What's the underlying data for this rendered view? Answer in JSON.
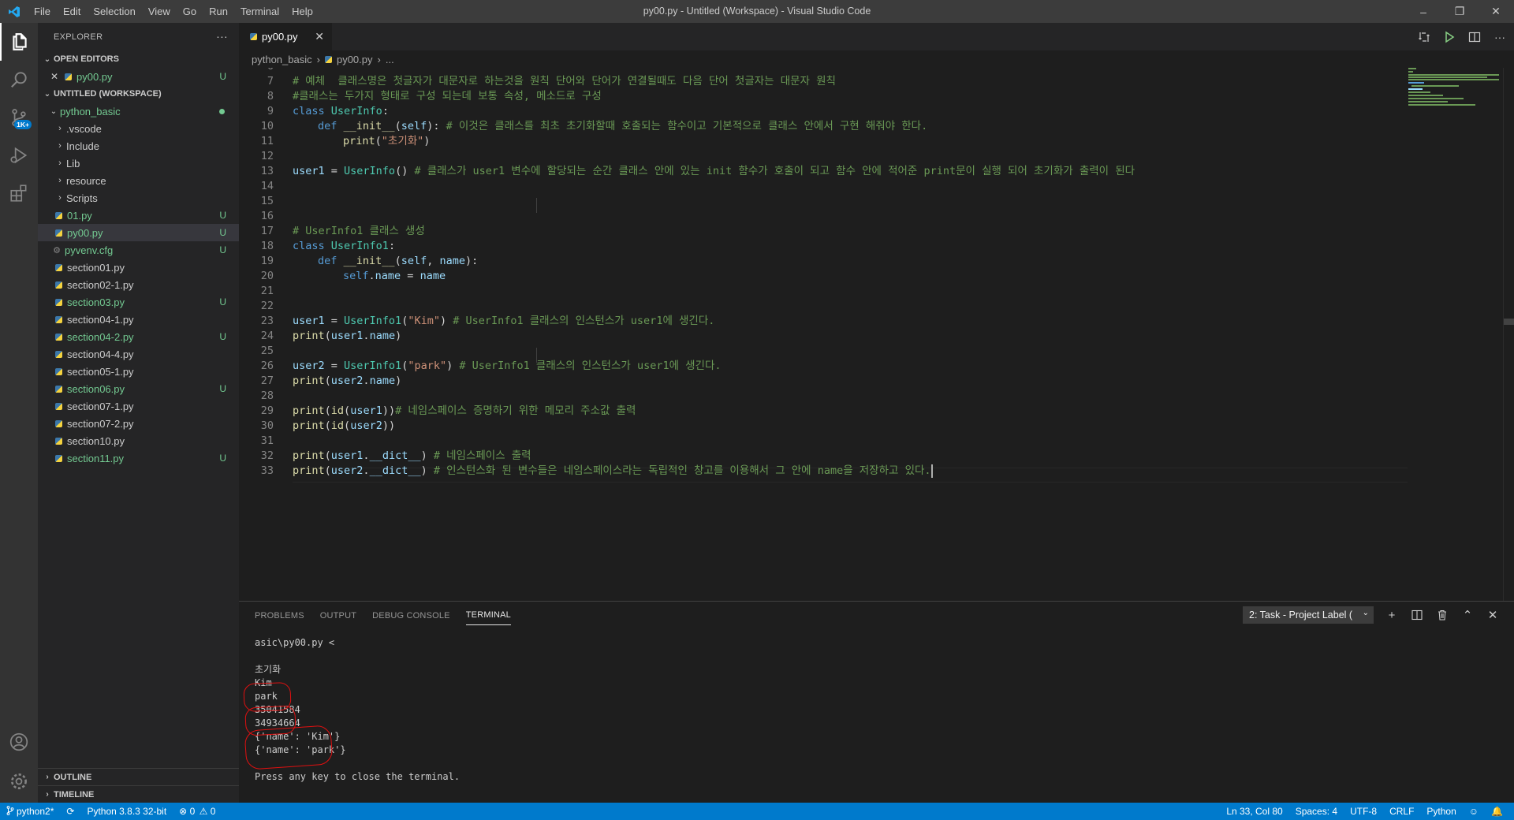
{
  "window": {
    "title": "py00.py - Untitled (Workspace) - Visual Studio Code",
    "menu": [
      "File",
      "Edit",
      "Selection",
      "View",
      "Go",
      "Run",
      "Terminal",
      "Help"
    ]
  },
  "activity": {
    "scm_badge": "1K+"
  },
  "sidebar": {
    "title": "EXPLORER",
    "more": "···",
    "open_editors": {
      "label": "OPEN EDITORS",
      "items": [
        {
          "name": "py00.py",
          "status": "U"
        }
      ]
    },
    "workspace": {
      "label": "UNTITLED (WORKSPACE)",
      "root": "python_basic",
      "folders": [
        ".vscode",
        "Include",
        "Lib",
        "resource",
        "Scripts"
      ],
      "files": [
        {
          "name": "01.py",
          "status": "U"
        },
        {
          "name": "py00.py",
          "status": "U"
        },
        {
          "name": "pyvenv.cfg",
          "status": "U"
        },
        {
          "name": "section01.py",
          "status": ""
        },
        {
          "name": "section02-1.py",
          "status": ""
        },
        {
          "name": "section03.py",
          "status": "U"
        },
        {
          "name": "section04-1.py",
          "status": ""
        },
        {
          "name": "section04-2.py",
          "status": "U"
        },
        {
          "name": "section04-4.py",
          "status": ""
        },
        {
          "name": "section05-1.py",
          "status": ""
        },
        {
          "name": "section06.py",
          "status": "U"
        },
        {
          "name": "section07-1.py",
          "status": ""
        },
        {
          "name": "section07-2.py",
          "status": ""
        },
        {
          "name": "section10.py",
          "status": ""
        },
        {
          "name": "section11.py",
          "status": "U"
        }
      ]
    },
    "outline": "OUTLINE",
    "timeline": "TIMELINE"
  },
  "editor": {
    "tab": "py00.py",
    "breadcrumb": [
      "python_basic",
      "py00.py",
      "..."
    ],
    "lines": {
      "n6": "6",
      "n7": "7",
      "l7": "# 예체  클래스명은 첫글자가 대문자로 하는것을 원칙 단어와 단어가 연결될때도 다음 단어 첫글자는 대문자 원칙",
      "n8": "8",
      "l8": "#클래스는 두가지 형태로 구성 되는데 보통 속성, 메소드로 구성",
      "n9": "9",
      "l9_kw": "class",
      "l9_name": "UserInfo",
      "l9_p": ":",
      "n10": "10",
      "l10_kw": "def",
      "l10_fn": "__init__",
      "l10_p1": "(",
      "l10_self": "self",
      "l10_p2": "): ",
      "l10_c": "# 이것은 클래스를 최초 초기화할때 호출되는 함수이고 기본적으로 클래스 안에서 구현 해줘야 한다.",
      "n11": "11",
      "l11_fn": "print",
      "l11_p1": "(",
      "l11_s": "\"초기화\"",
      "l11_p2": ")",
      "n12": "12",
      "n13": "13",
      "l13_v": "user1",
      "l13_p1": " = ",
      "l13_t": "UserInfo",
      "l13_p2": "() ",
      "l13_c": "# 클래스가 user1 변수에 할당되는 순간 클래스 안에 있는 init 함수가 호출이 되고 함수 안에 적어준 print문이 실행 되어 초기화가 출력이 된다",
      "n14": "14",
      "n15": "15",
      "n16": "16",
      "n17": "17",
      "l17": "# UserInfo1 클래스 생성",
      "n18": "18",
      "l18_kw": "class",
      "l18_name": "UserInfo1",
      "l18_p": ":",
      "n19": "19",
      "l19_kw": "def",
      "l19_fn": "__init__",
      "l19_p1": "(",
      "l19_self": "self",
      "l19_p2": ", ",
      "l19_name": "name",
      "l19_p3": "):",
      "n20": "20",
      "l20_self": "self",
      "l20_p": ".",
      "l20_v": "name",
      "l20_eq": " = ",
      "l20_v2": "name",
      "n21": "21",
      "n22": "22",
      "n23": "23",
      "l23_v": "user1",
      "l23_p1": " = ",
      "l23_t": "UserInfo1",
      "l23_p2": "(",
      "l23_s": "\"Kim\"",
      "l23_p3": ") ",
      "l23_c": "# UserInfo1 클래스의 인스턴스가 user1에 생긴다.",
      "n24": "24",
      "l24_fn": "print",
      "l24_p1": "(",
      "l24_v": "user1",
      "l24_p2": ".",
      "l24_v2": "name",
      "l24_p3": ")",
      "n25": "25",
      "n26": "26",
      "l26_v": "user2",
      "l26_p1": " = ",
      "l26_t": "UserInfo1",
      "l26_p2": "(",
      "l26_s": "\"park\"",
      "l26_p3": ") ",
      "l26_c": "# UserInfo1 클래스의 인스턴스가 user1에 생긴다.",
      "n27": "27",
      "l27_fn": "print",
      "l27_p1": "(",
      "l27_v": "user2",
      "l27_p2": ".",
      "l27_v2": "name",
      "l27_p3": ")",
      "n28": "28",
      "n29": "29",
      "l29_fn": "print",
      "l29_p1": "(",
      "l29_fn2": "id",
      "l29_p2": "(",
      "l29_v": "user1",
      "l29_p3": "))",
      "l29_c": "# 네임스페이스 증명하기 위한 메모리 주소값 출력",
      "n30": "30",
      "l30_fn": "print",
      "l30_p1": "(",
      "l30_fn2": "id",
      "l30_p2": "(",
      "l30_v": "user2",
      "l30_p3": "))",
      "n31": "31",
      "n32": "32",
      "l32_fn": "print",
      "l32_p1": "(",
      "l32_v": "user1",
      "l32_p2": ".",
      "l32_v2": "__dict__",
      "l32_p3": ") ",
      "l32_c": "# 네임스페이스 출력",
      "n33": "33",
      "l33_fn": "print",
      "l33_p1": "(",
      "l33_v": "user2",
      "l33_p2": ".",
      "l33_v2": "__dict__",
      "l33_p3": ") ",
      "l33_c": "# 인스턴스화 된 변수들은 네임스페이스라는 독립적인 창고를 이용해서 그 안에 name을 저장하고 있다."
    }
  },
  "panel": {
    "tabs": [
      "PROBLEMS",
      "OUTPUT",
      "DEBUG CONSOLE",
      "TERMINAL"
    ],
    "terminal_select": "2: Task - Project Label (",
    "terminal_lines": [
      "asic\\py00.py <",
      "",
      "초기화",
      "Kim",
      "park",
      "35041584",
      "34934664",
      "{'name': 'Kim'}",
      "{'name': 'park'}",
      "",
      "Press any key to close the terminal."
    ]
  },
  "status": {
    "branch": "python2*",
    "interpreter": "Python 3.8.3 32-bit",
    "errors": "0",
    "warnings": "0",
    "position": "Ln 33, Col 80",
    "spaces": "Spaces: 4",
    "encoding": "UTF-8",
    "eol": "CRLF",
    "language": "Python"
  },
  "colors": {
    "accent": "#007acc",
    "git_untracked": "#73c991",
    "annotation_circle": "#e01010"
  }
}
